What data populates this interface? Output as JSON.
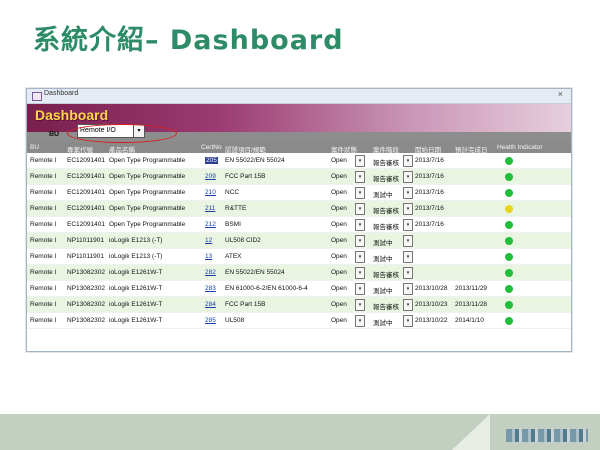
{
  "slide": {
    "title": "系統介紹– Dashboard"
  },
  "window": {
    "title": "Dashboard",
    "close": "×"
  },
  "banner": {
    "title": "Dashboard"
  },
  "filter": {
    "bu_label": "BU",
    "bu_value": "Remote I/O",
    "dropdown_glyph": "▾"
  },
  "columns": [
    "BU",
    "專案代號",
    "產品名稱",
    "CertNo",
    "認證項目/規範",
    "案件狀態",
    "案件階段",
    "開始日期",
    "預計完成日",
    "Health Indicator"
  ],
  "rows": [
    {
      "bu": "Remote I",
      "project": "EC12091401",
      "product": "Open Type Programmable",
      "cert": "205",
      "spec": "EN 55022/EN 55024",
      "status": "Open",
      "stage": "報告審核",
      "start": "2013/7/16",
      "due": "",
      "health": "green",
      "cert_selected": true
    },
    {
      "bu": "Remote I",
      "project": "EC12091401",
      "product": "Open Type Programmable",
      "cert": "209",
      "spec": "FCC Part 15B",
      "status": "Open",
      "stage": "報告審核",
      "start": "2013/7/16",
      "due": "",
      "health": "green"
    },
    {
      "bu": "Remote I",
      "project": "EC12091401",
      "product": "Open Type Programmable",
      "cert": "210",
      "spec": "NCC",
      "status": "Open",
      "stage": "測試中",
      "start": "2013/7/16",
      "due": "",
      "health": "green"
    },
    {
      "bu": "Remote I",
      "project": "EC12091401",
      "product": "Open Type Programmable",
      "cert": "211",
      "spec": "R&TTE",
      "status": "Open",
      "stage": "報告審核",
      "start": "2013/7/16",
      "due": "",
      "health": "yellow"
    },
    {
      "bu": "Remote I",
      "project": "EC12091401",
      "product": "Open Type Programmable",
      "cert": "212",
      "spec": "BSMI",
      "status": "Open",
      "stage": "報告審核",
      "start": "2013/7/16",
      "due": "",
      "health": "green"
    },
    {
      "bu": "Remote I",
      "project": "NP11011901",
      "product": "ioLogik E1213 (-T)",
      "cert": "12",
      "spec": "UL508 CID2",
      "status": "Open",
      "stage": "測試中",
      "start": "",
      "due": "",
      "health": "green"
    },
    {
      "bu": "Remote I",
      "project": "NP11011901",
      "product": "ioLogik E1213 (-T)",
      "cert": "13",
      "spec": "ATEX",
      "status": "Open",
      "stage": "測試中",
      "start": "",
      "due": "",
      "health": "green"
    },
    {
      "bu": "Remote I",
      "project": "NP13082302",
      "product": "ioLogik E1261W-T",
      "cert": "282",
      "spec": "EN 55022/EN 55024",
      "status": "Open",
      "stage": "報告審核",
      "start": "",
      "due": "",
      "health": "green"
    },
    {
      "bu": "Remote I",
      "project": "NP13082302",
      "product": "ioLogik E1261W-T",
      "cert": "283",
      "spec": "EN 61000-6-2/EN 61000-6-4",
      "status": "Open",
      "stage": "測試中",
      "start": "2013/10/28",
      "due": "2013/11/29",
      "health": "green"
    },
    {
      "bu": "Remote I",
      "project": "NP13082302",
      "product": "ioLogik E1261W-T",
      "cert": "284",
      "spec": "FCC Part 15B",
      "status": "Open",
      "stage": "報告審核",
      "start": "2013/10/23",
      "due": "2013/11/28",
      "health": "green"
    },
    {
      "bu": "Remote I",
      "project": "NP13082302",
      "product": "ioLogik E1261W-T",
      "cert": "285",
      "spec": "UL508",
      "status": "Open",
      "stage": "測試中",
      "start": "2013/10/22",
      "due": "2014/1/10",
      "health": "green"
    }
  ],
  "colors": {
    "green": "#1fbf3a",
    "yellow": "#e8d51c",
    "accent_title": "#2e8b68"
  }
}
